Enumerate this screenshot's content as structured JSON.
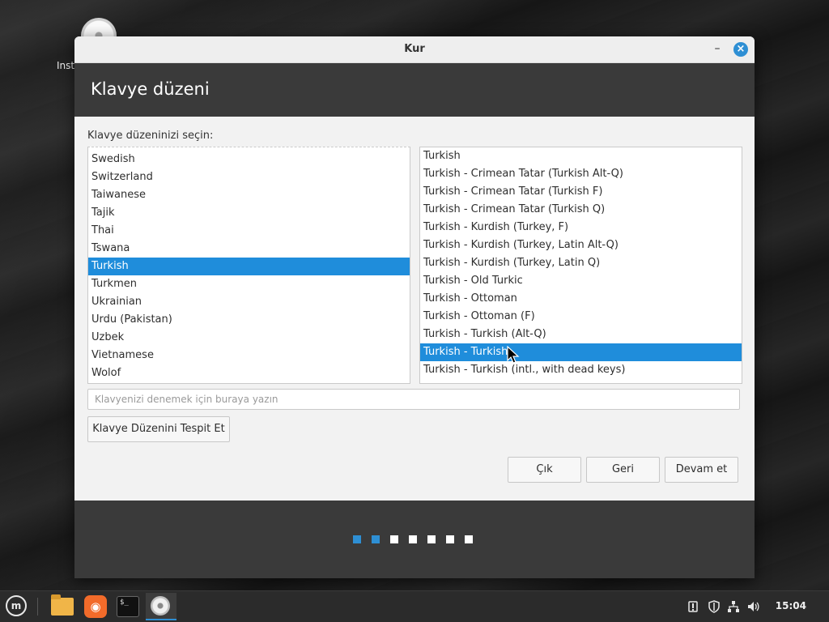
{
  "desktop": {
    "icon_label": "Inst"
  },
  "window": {
    "title": "Kur",
    "minimize": "–",
    "close": "×"
  },
  "header": {
    "heading": "Klavye düzeni"
  },
  "content": {
    "prompt": "Klavye düzeninizi seçin:",
    "layouts": [
      "Swedish",
      "Switzerland",
      "Taiwanese",
      "Tajik",
      "Thai",
      "Tswana",
      "Turkish",
      "Turkmen",
      "Ukrainian",
      "Urdu (Pakistan)",
      "Uzbek",
      "Vietnamese",
      "Wolof"
    ],
    "selected_layout": "Turkish",
    "variants": [
      "Turkish",
      "Turkish - Crimean Tatar (Turkish Alt-Q)",
      "Turkish - Crimean Tatar (Turkish F)",
      "Turkish - Crimean Tatar (Turkish Q)",
      "Turkish - Kurdish (Turkey, F)",
      "Turkish - Kurdish (Turkey, Latin Alt-Q)",
      "Turkish - Kurdish (Turkey, Latin Q)",
      "Turkish - Old Turkic",
      "Turkish - Ottoman",
      "Turkish - Ottoman (F)",
      "Turkish - Turkish (Alt-Q)",
      "Turkish - Turkish",
      "Turkish - Turkish (intl., with dead keys)"
    ],
    "selected_variant": "Turkish - Turkish",
    "test_input": {
      "value": "",
      "placeholder": "Klavyenizi denemek için buraya yazın"
    },
    "detect_button": "Klavye Düzenini Tespit Et",
    "buttons": {
      "quit": "Çık",
      "back": "Geri",
      "next": "Devam et"
    }
  },
  "footer": {
    "steps_total": 7,
    "steps_active": 2
  },
  "panel": {
    "launchers": [
      "menu-icon",
      "files-icon",
      "firefox-icon",
      "terminal-icon",
      "installer-icon"
    ],
    "tray": [
      "update-manager-icon",
      "shield-icon",
      "network-icon",
      "volume-icon"
    ],
    "clock": "15:04"
  },
  "colors": {
    "accent": "#1f8ddb",
    "header_bg": "#3a3a3a",
    "panel_bg": "#2b2b2b"
  }
}
